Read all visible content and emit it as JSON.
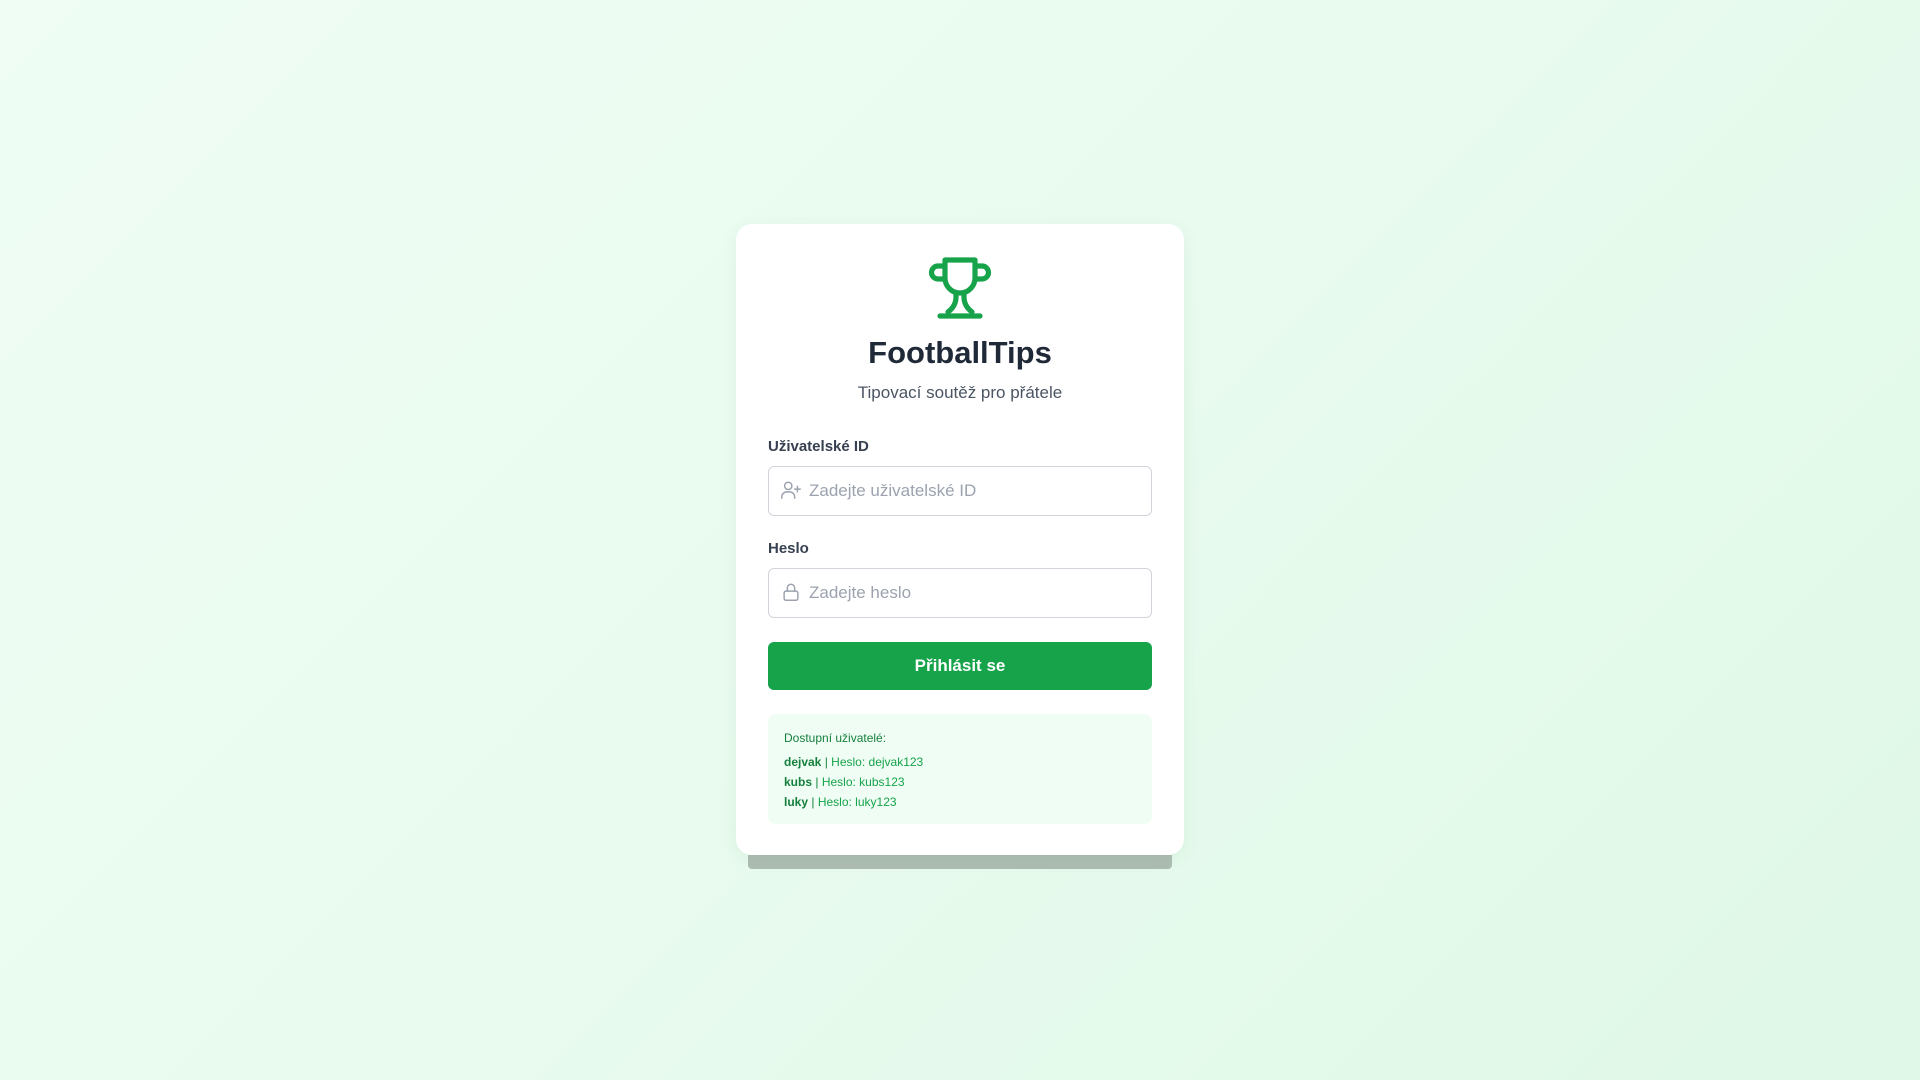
{
  "app": {
    "title": "FootballTips",
    "subtitle": "Tipovací soutěž pro přátele",
    "logo_icon": "trophy-icon"
  },
  "form": {
    "user_id": {
      "label": "Uživatelské ID",
      "placeholder": "Zadejte uživatelské ID",
      "value": "",
      "icon": "user-plus-icon"
    },
    "password": {
      "label": "Heslo",
      "placeholder": "Zadejte heslo",
      "value": "",
      "icon": "lock-icon"
    },
    "submit_label": "Přihlásit se"
  },
  "available_users": {
    "title": "Dostupní uživatelé:",
    "separator": "|",
    "users": [
      {
        "name": "dejvak",
        "password_text": "Heslo: dejvak123"
      },
      {
        "name": "kubs",
        "password_text": "Heslo: kubs123"
      },
      {
        "name": "luky",
        "password_text": "Heslo: luky123"
      }
    ]
  },
  "colors": {
    "accent": "#16a34a",
    "accent_dark": "#15803d",
    "box_bg": "#f0fdf4",
    "title_text": "#1f2937"
  }
}
